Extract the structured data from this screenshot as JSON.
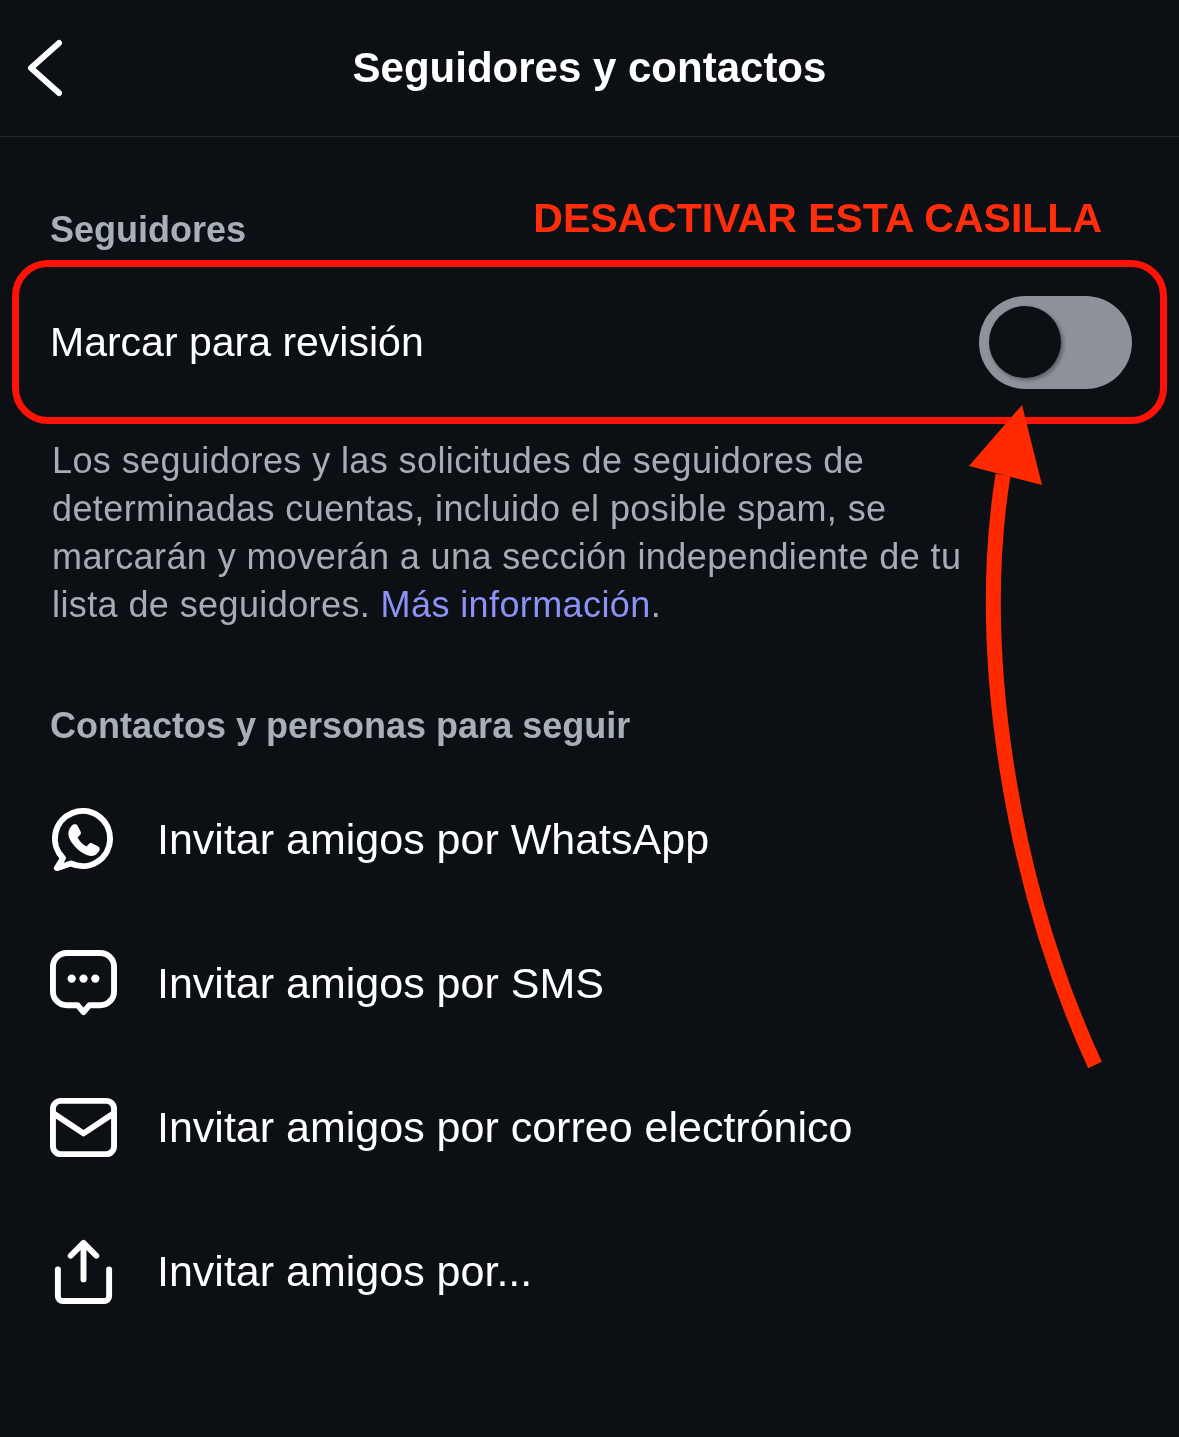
{
  "header": {
    "title": "Seguidores y contactos"
  },
  "followers": {
    "heading": "Seguidores",
    "annotation": {
      "text": "DESACTIVAR ESTA CASILLA",
      "arrow": true
    },
    "toggle_row": {
      "label": "Marcar para revisión",
      "on": false,
      "highlighted": true
    },
    "description": {
      "text": "Los seguidores y las solicitudes de seguidores de determinadas cuentas, incluido el posible spam, se marcarán y moverán a una sección independiente de tu lista de seguidores.",
      "link": "Más información",
      "text_after": "."
    }
  },
  "contacts": {
    "heading": "Contactos y personas para seguir",
    "items": [
      {
        "kind": "whatsapp",
        "label": "Invitar amigos por WhatsApp"
      },
      {
        "kind": "sms",
        "label": "Invitar amigos por SMS"
      },
      {
        "kind": "email",
        "label": "Invitar amigos por correo electrónico"
      },
      {
        "kind": "share",
        "label": "Invitar amigos por..."
      }
    ]
  }
}
